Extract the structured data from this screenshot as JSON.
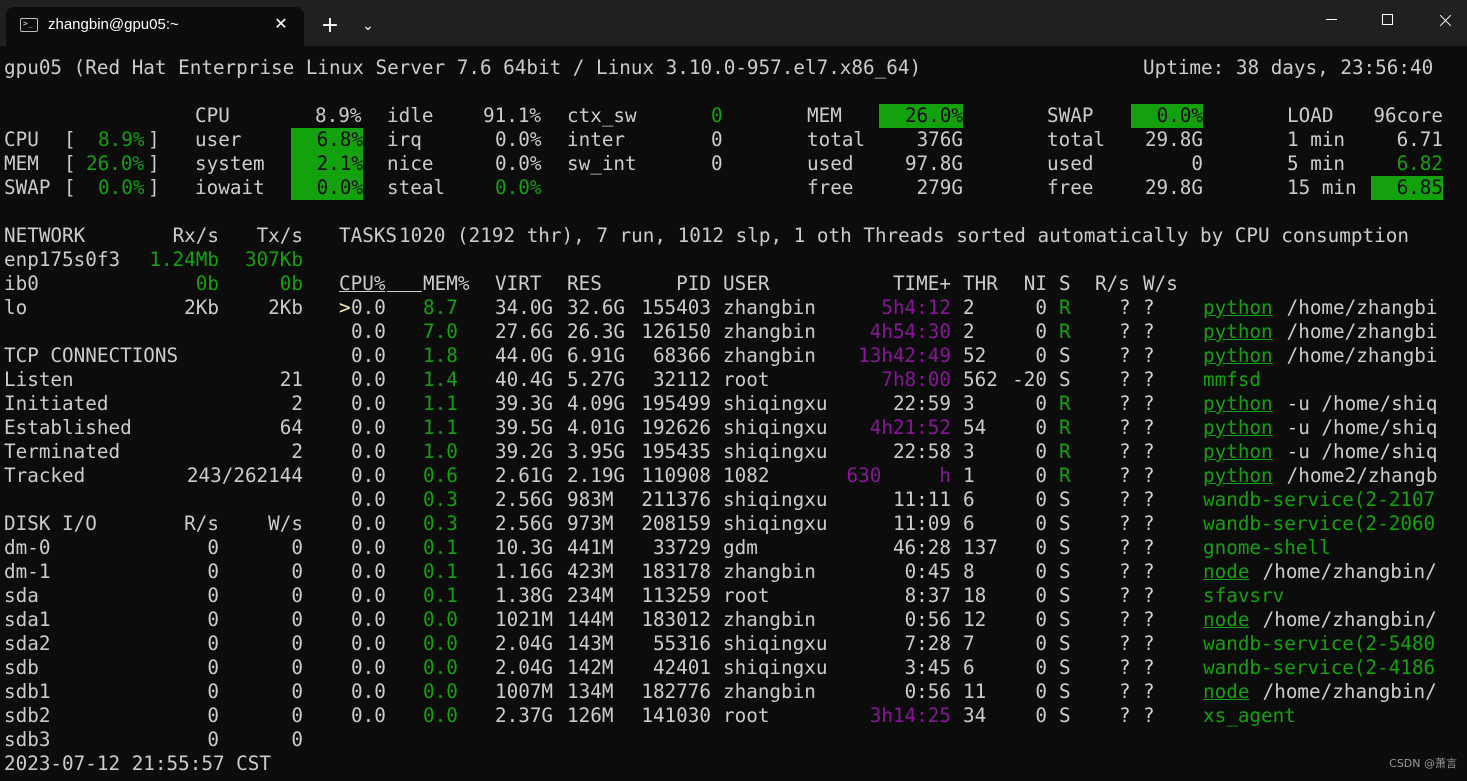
{
  "window": {
    "tab_title": "zhangbin@gpu05:~",
    "tab_close_glyph": "✕",
    "new_tab_glyph": "+",
    "dropdown_glyph": "⌄"
  },
  "colors": {
    "background": "#0c0c0c",
    "text": "#cccccc",
    "green": "#13a10e",
    "magenta": "#881798",
    "titlebar": "#202020"
  },
  "header": {
    "system": "gpu05 (Red Hat Enterprise Linux Server 7.6 64bit / Linux 3.10.0-957.el7.x86_64)",
    "uptime": "Uptime: 38 days, 23:56:40"
  },
  "quicklook": {
    "cpu_label": "CPU",
    "cpu_value": "8.9%",
    "mem_label": "MEM",
    "mem_value": "26.0%",
    "swap_label": "SWAP",
    "swap_value": "0.0%"
  },
  "cpu": {
    "title": "CPU",
    "total": "8.9%",
    "user_label": "user",
    "user": "6.8%",
    "system_label": "system",
    "system": "2.1%",
    "iowait_label": "iowait",
    "iowait": "0.0%",
    "idle_label": "idle",
    "idle": "91.1%",
    "irq_label": "irq",
    "irq": "0.0%",
    "nice_label": "nice",
    "nice": "0.0%",
    "steal_label": "steal",
    "steal": "0.0%",
    "ctx_sw_label": "ctx_sw",
    "ctx_sw": "0",
    "inter_label": "inter",
    "inter": "0",
    "sw_int_label": "sw_int",
    "sw_int": "0"
  },
  "mem": {
    "title": "MEM",
    "percent": "26.0%",
    "total_label": "total",
    "total": "376G",
    "used_label": "used",
    "used": "97.8G",
    "free_label": "free",
    "free": "279G"
  },
  "swap": {
    "title": "SWAP",
    "percent": "0.0%",
    "total_label": "total",
    "total": "29.8G",
    "used_label": "used",
    "used": "0",
    "free_label": "free",
    "free": "29.8G"
  },
  "load": {
    "title": "LOAD",
    "cores": "96core",
    "min1_label": "1 min",
    "min1": "6.71",
    "min5_label": "5 min",
    "min5": "6.82",
    "min15_label": "15 min",
    "min15": "6.85"
  },
  "network": {
    "title": "NETWORK",
    "rx_header": "Rx/s",
    "tx_header": "Tx/s",
    "interfaces": [
      {
        "name": "enp175s0f3",
        "rx": "1.24Mb",
        "tx": "307Kb",
        "color": "#13a10e"
      },
      {
        "name": "ib0",
        "rx": "0b",
        "tx": "0b",
        "color": "#13a10e"
      },
      {
        "name": "lo",
        "rx": "2Kb",
        "tx": "2Kb",
        "color": "#cccccc"
      }
    ]
  },
  "tcp": {
    "title": "TCP CONNECTIONS",
    "rows": [
      {
        "label": "Listen",
        "value": "21"
      },
      {
        "label": "Initiated",
        "value": "2"
      },
      {
        "label": "Established",
        "value": "64"
      },
      {
        "label": "Terminated",
        "value": "2"
      },
      {
        "label": "Tracked",
        "value": "243/262144"
      }
    ]
  },
  "disk": {
    "title": "DISK I/O",
    "r_header": "R/s",
    "w_header": "W/s",
    "rows": [
      {
        "name": "dm-0",
        "r": "0",
        "w": "0"
      },
      {
        "name": "dm-1",
        "r": "0",
        "w": "0"
      },
      {
        "name": "sda",
        "r": "0",
        "w": "0"
      },
      {
        "name": "sda1",
        "r": "0",
        "w": "0"
      },
      {
        "name": "sda2",
        "r": "0",
        "w": "0"
      },
      {
        "name": "sdb",
        "r": "0",
        "w": "0"
      },
      {
        "name": "sdb1",
        "r": "0",
        "w": "0"
      },
      {
        "name": "sdb2",
        "r": "0",
        "w": "0"
      },
      {
        "name": "sdb3",
        "r": "0",
        "w": "0"
      }
    ]
  },
  "tasks": {
    "label": "TASKS",
    "summary": "1020 (2192 thr), 7 run, 1012 slp, 1 oth Threads sorted automatically by CPU consumption"
  },
  "process_table": {
    "headers": {
      "cpu": "CPU%",
      "mem": "MEM%",
      "virt": "VIRT",
      "res": "RES",
      "pid": "PID",
      "user": "USER",
      "time": "TIME+",
      "thr": "THR",
      "ni": "NI",
      "s": "S",
      "rs": "R/s",
      "ws": "W/s"
    },
    "rows": [
      {
        "sel": ">",
        "cpu": "0.0",
        "mem": "8.7",
        "virt": "34.0G",
        "res": "32.6G",
        "pid": "155403",
        "user": "zhangbin",
        "time": "5h4:12",
        "time_color": "#881798",
        "thr": "2",
        "ni": "0",
        "s": "R",
        "rs": "?",
        "ws": "?",
        "cmd": "python",
        "args": " /home/zhangbi"
      },
      {
        "sel": " ",
        "cpu": "0.0",
        "mem": "7.0",
        "virt": "27.6G",
        "res": "26.3G",
        "pid": "126150",
        "user": "zhangbin",
        "time": "4h54:30",
        "time_color": "#881798",
        "thr": "2",
        "ni": "0",
        "s": "R",
        "rs": "?",
        "ws": "?",
        "cmd": "python",
        "args": " /home/zhangbi"
      },
      {
        "sel": " ",
        "cpu": "0.0",
        "mem": "1.8",
        "virt": "44.0G",
        "res": "6.91G",
        "pid": "68366",
        "user": "zhangbin",
        "time": "13h42:49",
        "time_color": "#881798",
        "thr": "52",
        "ni": "0",
        "s": "S",
        "rs": "?",
        "ws": "?",
        "cmd": "python",
        "args": " /home/zhangbi"
      },
      {
        "sel": " ",
        "cpu": "0.0",
        "mem": "1.4",
        "virt": "40.4G",
        "res": "5.27G",
        "pid": "32112",
        "user": "root",
        "time": "7h8:00",
        "time_color": "#881798",
        "thr": "562",
        "ni": "-20",
        "s": "S",
        "rs": "?",
        "ws": "?",
        "cmd": "mmfsd",
        "args": ""
      },
      {
        "sel": " ",
        "cpu": "0.0",
        "mem": "1.1",
        "virt": "39.3G",
        "res": "4.09G",
        "pid": "195499",
        "user": "shiqingxu",
        "time": "22:59",
        "time_color": "#cccccc",
        "thr": "3",
        "ni": "0",
        "s": "R",
        "rs": "?",
        "ws": "?",
        "cmd": "python",
        "args": " -u /home/shiq"
      },
      {
        "sel": " ",
        "cpu": "0.0",
        "mem": "1.1",
        "virt": "39.5G",
        "res": "4.01G",
        "pid": "192626",
        "user": "shiqingxu",
        "time": "4h21:52",
        "time_color": "#881798",
        "thr": "54",
        "ni": "0",
        "s": "R",
        "rs": "?",
        "ws": "?",
        "cmd": "python",
        "args": " -u /home/shiq"
      },
      {
        "sel": " ",
        "cpu": "0.0",
        "mem": "1.0",
        "virt": "39.2G",
        "res": "3.95G",
        "pid": "195435",
        "user": "shiqingxu",
        "time": "22:58",
        "time_color": "#cccccc",
        "thr": "3",
        "ni": "0",
        "s": "R",
        "rs": "?",
        "ws": "?",
        "cmd": "python",
        "args": " -u /home/shiq"
      },
      {
        "sel": " ",
        "cpu": "0.0",
        "mem": "0.6",
        "virt": "2.61G",
        "res": "2.19G",
        "pid": "110908",
        "user": "1082",
        "time": "630     h",
        "time_color": "#881798",
        "thr": "1",
        "ni": "0",
        "s": "R",
        "rs": "?",
        "ws": "?",
        "cmd": "python",
        "args": " /home2/zhangb"
      },
      {
        "sel": " ",
        "cpu": "0.0",
        "mem": "0.3",
        "virt": "2.56G",
        "res": "983M",
        "pid": "211376",
        "user": "shiqingxu",
        "time": "11:11",
        "time_color": "#cccccc",
        "thr": "6",
        "ni": "0",
        "s": "S",
        "rs": "?",
        "ws": "?",
        "cmd": "wandb-service(2-2107",
        "args": ""
      },
      {
        "sel": " ",
        "cpu": "0.0",
        "mem": "0.3",
        "virt": "2.56G",
        "res": "973M",
        "pid": "208159",
        "user": "shiqingxu",
        "time": "11:09",
        "time_color": "#cccccc",
        "thr": "6",
        "ni": "0",
        "s": "S",
        "rs": "?",
        "ws": "?",
        "cmd": "wandb-service(2-2060",
        "args": ""
      },
      {
        "sel": " ",
        "cpu": "0.0",
        "mem": "0.1",
        "virt": "10.3G",
        "res": "441M",
        "pid": "33729",
        "user": "gdm",
        "time": "46:28",
        "time_color": "#cccccc",
        "thr": "137",
        "ni": "0",
        "s": "S",
        "rs": "?",
        "ws": "?",
        "cmd": "gnome-shell",
        "args": ""
      },
      {
        "sel": " ",
        "cpu": "0.0",
        "mem": "0.1",
        "virt": "1.16G",
        "res": "423M",
        "pid": "183178",
        "user": "zhangbin",
        "time": "0:45",
        "time_color": "#cccccc",
        "thr": "8",
        "ni": "0",
        "s": "S",
        "rs": "?",
        "ws": "?",
        "cmd": "node",
        "args": " /home/zhangbin/"
      },
      {
        "sel": " ",
        "cpu": "0.0",
        "mem": "0.1",
        "virt": "1.38G",
        "res": "234M",
        "pid": "113259",
        "user": "root",
        "time": "8:37",
        "time_color": "#cccccc",
        "thr": "18",
        "ni": "0",
        "s": "S",
        "rs": "?",
        "ws": "?",
        "cmd": "sfavsrv",
        "args": ""
      },
      {
        "sel": " ",
        "cpu": "0.0",
        "mem": "0.0",
        "virt": "1021M",
        "res": "144M",
        "pid": "183012",
        "user": "zhangbin",
        "time": "0:56",
        "time_color": "#cccccc",
        "thr": "12",
        "ni": "0",
        "s": "S",
        "rs": "?",
        "ws": "?",
        "cmd": "node",
        "args": " /home/zhangbin/"
      },
      {
        "sel": " ",
        "cpu": "0.0",
        "mem": "0.0",
        "virt": "2.04G",
        "res": "143M",
        "pid": "55316",
        "user": "shiqingxu",
        "time": "7:28",
        "time_color": "#cccccc",
        "thr": "7",
        "ni": "0",
        "s": "S",
        "rs": "?",
        "ws": "?",
        "cmd": "wandb-service(2-5480",
        "args": ""
      },
      {
        "sel": " ",
        "cpu": "0.0",
        "mem": "0.0",
        "virt": "2.04G",
        "res": "142M",
        "pid": "42401",
        "user": "shiqingxu",
        "time": "3:45",
        "time_color": "#cccccc",
        "thr": "6",
        "ni": "0",
        "s": "S",
        "rs": "?",
        "ws": "?",
        "cmd": "wandb-service(2-4186",
        "args": ""
      },
      {
        "sel": " ",
        "cpu": "0.0",
        "mem": "0.0",
        "virt": "1007M",
        "res": "134M",
        "pid": "182776",
        "user": "zhangbin",
        "time": "0:56",
        "time_color": "#cccccc",
        "thr": "11",
        "ni": "0",
        "s": "S",
        "rs": "?",
        "ws": "?",
        "cmd": "node",
        "args": " /home/zhangbin/"
      },
      {
        "sel": " ",
        "cpu": "0.0",
        "mem": "0.0",
        "virt": "2.37G",
        "res": "126M",
        "pid": "141030",
        "user": "root",
        "time": "3h14:25",
        "time_color": "#881798",
        "thr": "34",
        "ni": "0",
        "s": "S",
        "rs": "?",
        "ws": "?",
        "cmd": "xs_agent",
        "args": ""
      }
    ]
  },
  "footer": {
    "datetime": "2023-07-12 21:55:57 CST"
  },
  "watermark": "CSDN @萧言"
}
